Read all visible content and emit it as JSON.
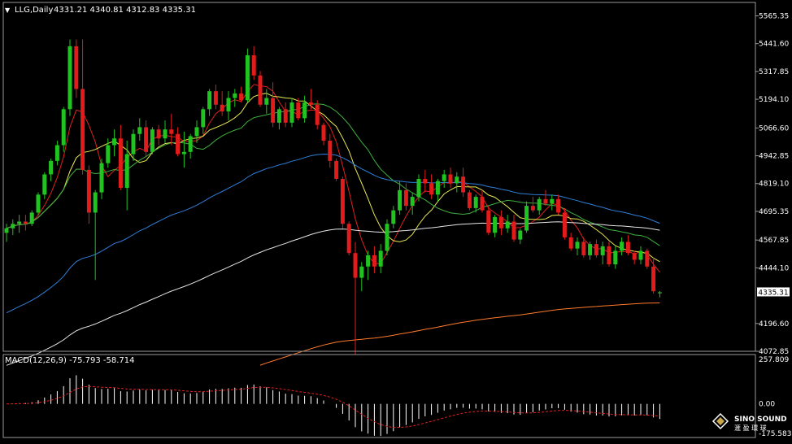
{
  "header": {
    "menu_glyph": "▼",
    "symbol_text": "LLG,Daily",
    "ohlc_text": "4331.21 4340.81 4312.83 4335.31"
  },
  "macd_label": "MACD(12,26,9) -75.793 -58.714",
  "price_badge": "4335.31",
  "watermark": {
    "brand": "SINO SOUND",
    "chars": "滙 盈 環 球"
  },
  "colors": {
    "background": "#000000",
    "grid": "#1e1e1e",
    "frame": "#9a9a9a",
    "bull": "#21c321",
    "bear": "#e21b1b",
    "ma_red": "#e02020",
    "ma_yellow": "#e8e850",
    "ma_green": "#40b040",
    "ma_blue": "#2f7fd8",
    "ma_white": "#e6e6e6",
    "ma_orange": "#ff7a2a",
    "macd_hist": "#ffffff",
    "macd_signal": "#e02020"
  },
  "chart_data": [
    {
      "type": "candlestick",
      "title": "LLG,Daily",
      "ohlc_last": {
        "open": 4331.21,
        "high": 4340.81,
        "low": 4312.83,
        "close": 4335.31
      },
      "ylim": [
        4072.85,
        5625.0
      ],
      "yticks": [
        "5565.35",
        "5441.60",
        "5317.85",
        "5194.10",
        "5066.60",
        "4942.85",
        "4819.10",
        "4695.35",
        "4567.85",
        "4444.10",
        "4335.31",
        "4196.60",
        "4072.85"
      ],
      "ytick_values": [
        5565.35,
        5441.6,
        5317.85,
        5194.1,
        5066.6,
        4942.85,
        4819.1,
        4695.35,
        4567.85,
        4444.1,
        4335.31,
        4196.6,
        4072.85
      ],
      "candles": [
        [
          4600,
          4640,
          4560,
          4620
        ],
        [
          4620,
          4660,
          4590,
          4640
        ],
        [
          4640,
          4680,
          4600,
          4650
        ],
        [
          4650,
          4680,
          4610,
          4640
        ],
        [
          4640,
          4700,
          4630,
          4690
        ],
        [
          4690,
          4780,
          4680,
          4770
        ],
        [
          4770,
          4870,
          4750,
          4860
        ],
        [
          4860,
          4930,
          4830,
          4920
        ],
        [
          4920,
          5010,
          4900,
          4990
        ],
        [
          4990,
          5160,
          4960,
          5150
        ],
        [
          5150,
          5460,
          5120,
          5430
        ],
        [
          5430,
          5460,
          5200,
          5240
        ],
        [
          5240,
          5460,
          4860,
          4880
        ],
        [
          4880,
          4900,
          4640,
          4690
        ],
        [
          4690,
          4790,
          4390,
          4780
        ],
        [
          4780,
          4930,
          4750,
          4910
        ],
        [
          4910,
          5020,
          4890,
          4990
        ],
        [
          4990,
          5060,
          4940,
          5020
        ],
        [
          5020,
          5080,
          4790,
          4800
        ],
        [
          4800,
          5010,
          4700,
          4950
        ],
        [
          4950,
          5060,
          4920,
          5040
        ],
        [
          5040,
          5110,
          5010,
          5070
        ],
        [
          5070,
          5100,
          4940,
          4960
        ],
        [
          4960,
          5070,
          4950,
          5060
        ],
        [
          5060,
          5080,
          4990,
          5020
        ],
        [
          5020,
          5100,
          5000,
          5060
        ],
        [
          5060,
          5130,
          4990,
          5040
        ],
        [
          5040,
          5070,
          4940,
          4950
        ],
        [
          4950,
          5050,
          4890,
          4960
        ],
        [
          4960,
          5040,
          4930,
          5030
        ],
        [
          5030,
          5100,
          5000,
          5070
        ],
        [
          5070,
          5160,
          5040,
          5150
        ],
        [
          5150,
          5240,
          5120,
          5230
        ],
        [
          5230,
          5260,
          5150,
          5170
        ],
        [
          5170,
          5230,
          5120,
          5140
        ],
        [
          5140,
          5230,
          5100,
          5200
        ],
        [
          5200,
          5240,
          5160,
          5220
        ],
        [
          5220,
          5250,
          5180,
          5190
        ],
        [
          5190,
          5420,
          5180,
          5390
        ],
        [
          5390,
          5430,
          5280,
          5300
        ],
        [
          5300,
          5320,
          5160,
          5170
        ],
        [
          5170,
          5240,
          5130,
          5200
        ],
        [
          5200,
          5270,
          5070,
          5090
        ],
        [
          5090,
          5160,
          5060,
          5150
        ],
        [
          5150,
          5180,
          5070,
          5090
        ],
        [
          5090,
          5200,
          5070,
          5180
        ],
        [
          5180,
          5200,
          5100,
          5110
        ],
        [
          5110,
          5210,
          5090,
          5180
        ],
        [
          5180,
          5240,
          5150,
          5170
        ],
        [
          5170,
          5190,
          5060,
          5080
        ],
        [
          5080,
          5090,
          4990,
          5010
        ],
        [
          5010,
          5040,
          4890,
          4920
        ],
        [
          4920,
          4930,
          4830,
          4840
        ],
        [
          4840,
          4850,
          4620,
          4640
        ],
        [
          4640,
          4650,
          4500,
          4510
        ],
        [
          4510,
          4560,
          4060,
          4400
        ],
        [
          4400,
          4470,
          4340,
          4450
        ],
        [
          4450,
          4520,
          4390,
          4500
        ],
        [
          4500,
          4540,
          4420,
          4450
        ],
        [
          4450,
          4550,
          4420,
          4520
        ],
        [
          4520,
          4660,
          4500,
          4640
        ],
        [
          4640,
          4720,
          4620,
          4700
        ],
        [
          4700,
          4830,
          4680,
          4790
        ],
        [
          4790,
          4820,
          4700,
          4720
        ],
        [
          4720,
          4780,
          4680,
          4760
        ],
        [
          4760,
          4860,
          4740,
          4840
        ],
        [
          4840,
          4880,
          4780,
          4820
        ],
        [
          4820,
          4860,
          4750,
          4770
        ],
        [
          4770,
          4840,
          4740,
          4830
        ],
        [
          4830,
          4880,
          4800,
          4860
        ],
        [
          4860,
          4890,
          4800,
          4820
        ],
        [
          4820,
          4870,
          4780,
          4850
        ],
        [
          4850,
          4890,
          4760,
          4780
        ],
        [
          4780,
          4790,
          4700,
          4710
        ],
        [
          4710,
          4770,
          4690,
          4760
        ],
        [
          4760,
          4790,
          4690,
          4700
        ],
        [
          4700,
          4720,
          4590,
          4600
        ],
        [
          4600,
          4680,
          4580,
          4670
        ],
        [
          4670,
          4700,
          4590,
          4620
        ],
        [
          4620,
          4680,
          4600,
          4650
        ],
        [
          4650,
          4680,
          4560,
          4570
        ],
        [
          4570,
          4620,
          4550,
          4610
        ],
        [
          4610,
          4740,
          4600,
          4720
        ],
        [
          4720,
          4760,
          4690,
          4700
        ],
        [
          4700,
          4760,
          4680,
          4750
        ],
        [
          4750,
          4790,
          4720,
          4730
        ],
        [
          4730,
          4770,
          4700,
          4750
        ],
        [
          4750,
          4770,
          4680,
          4690
        ],
        [
          4690,
          4710,
          4570,
          4580
        ],
        [
          4580,
          4600,
          4520,
          4530
        ],
        [
          4530,
          4580,
          4500,
          4560
        ],
        [
          4560,
          4580,
          4490,
          4500
        ],
        [
          4500,
          4560,
          4480,
          4550
        ],
        [
          4550,
          4570,
          4490,
          4500
        ],
        [
          4500,
          4560,
          4460,
          4540
        ],
        [
          4540,
          4560,
          4450,
          4460
        ],
        [
          4460,
          4540,
          4440,
          4520
        ],
        [
          4520,
          4580,
          4500,
          4560
        ],
        [
          4560,
          4590,
          4500,
          4510
        ],
        [
          4510,
          4520,
          4460,
          4480
        ],
        [
          4480,
          4540,
          4460,
          4520
        ],
        [
          4520,
          4530,
          4440,
          4450
        ],
        [
          4450,
          4490,
          4330,
          4340
        ],
        [
          4331.21,
          4340.81,
          4312.83,
          4335.31
        ]
      ]
    },
    {
      "type": "bar",
      "title": "MACD(12,26,9)",
      "macd": -75.793,
      "signal": -58.714,
      "ylim": [
        -175.583,
        257.809
      ],
      "yticks": [
        "257.809",
        "0.00",
        "-175.583"
      ],
      "ytick_values": [
        257.809,
        0.0,
        -175.583
      ]
    }
  ]
}
